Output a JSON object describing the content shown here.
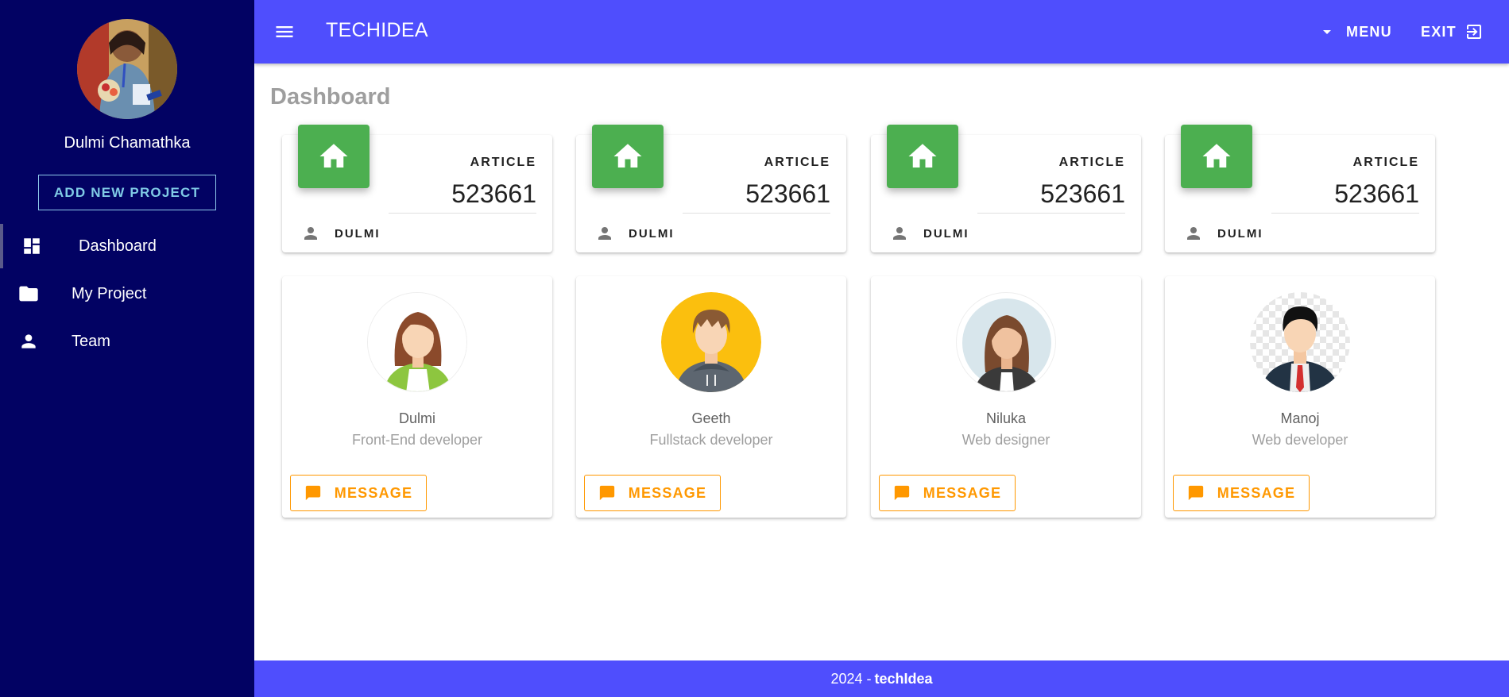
{
  "sidebar": {
    "profile_name": "Dulmi Chamathka",
    "add_project_label": "ADD NEW PROJECT",
    "items": [
      {
        "label": "Dashboard",
        "icon": "dashboard-icon"
      },
      {
        "label": "My Project",
        "icon": "folder-icon"
      },
      {
        "label": "Team",
        "icon": "person-icon"
      }
    ]
  },
  "header": {
    "brand": "TECHIDEA",
    "menu_label": "MENU",
    "exit_label": "EXIT"
  },
  "page_title": "Dashboard",
  "stats": [
    {
      "label": "ARTICLE",
      "value": "523661",
      "footer": "DULMI"
    },
    {
      "label": "ARTICLE",
      "value": "523661",
      "footer": "DULMI"
    },
    {
      "label": "ARTICLE",
      "value": "523661",
      "footer": "DULMI"
    },
    {
      "label": "ARTICLE",
      "value": "523661",
      "footer": "DULMI"
    }
  ],
  "team": [
    {
      "name": "Dulmi",
      "role": "Front-End developer",
      "button": "MESSAGE"
    },
    {
      "name": "Geeth",
      "role": "Fullstack developer",
      "button": "MESSAGE"
    },
    {
      "name": "Niluka",
      "role": "Web designer",
      "button": "MESSAGE"
    },
    {
      "name": "Manoj",
      "role": "Web developer",
      "button": "MESSAGE"
    }
  ],
  "footer": {
    "year": "2024 -",
    "brand": "techIdea"
  },
  "colors": {
    "sidebar": "#020263",
    "primary": "#4f4efd",
    "stat_icon": "#4caf50",
    "accent": "#ff9800"
  }
}
